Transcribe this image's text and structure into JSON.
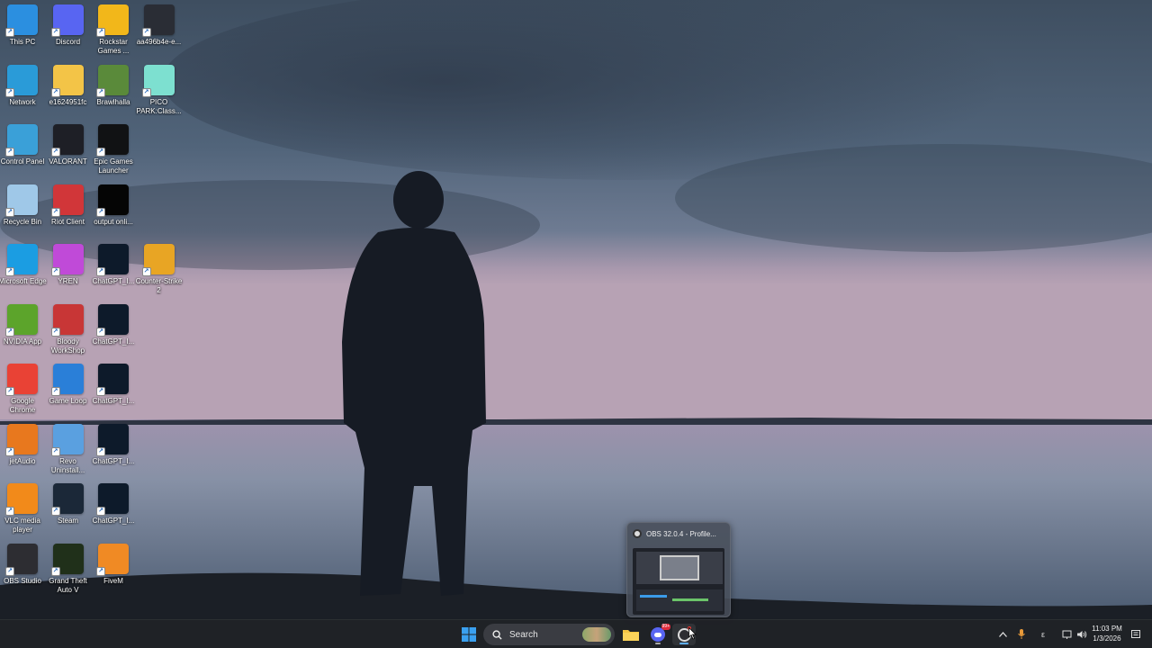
{
  "desktop": {
    "icons": [
      {
        "label": "This PC",
        "icon": "this-pc-icon",
        "color": "#2b8fe0"
      },
      {
        "label": "Discord",
        "icon": "discord-icon",
        "color": "#5865f2"
      },
      {
        "label": "Rockstar Games ...",
        "icon": "rockstar-icon",
        "color": "#f2b71a"
      },
      {
        "label": "aa496b4e-e...",
        "icon": "file-icon",
        "color": "#2a2d35"
      },
      {
        "label": "Network",
        "icon": "network-icon",
        "color": "#2a9bd8"
      },
      {
        "label": "e1624951fc",
        "icon": "folder-icon",
        "color": "#f3c447"
      },
      {
        "label": "Brawlhalla",
        "icon": "brawlhalla-icon",
        "color": "#5a8a3a"
      },
      {
        "label": "PICO PARK:Class...",
        "icon": "pico-park-icon",
        "color": "#7de0d0"
      },
      {
        "label": "Control Panel",
        "icon": "control-panel-icon",
        "color": "#3aa0d8"
      },
      {
        "label": "VALORANT",
        "icon": "valorant-icon",
        "color": "#1e1f26"
      },
      {
        "label": "Epic Games Launcher",
        "icon": "epic-games-icon",
        "color": "#111214"
      },
      {
        "label": "Recycle Bin",
        "icon": "recycle-bin-icon",
        "color": "#9fc8e8"
      },
      {
        "label": "Riot Client",
        "icon": "riot-client-icon",
        "color": "#d13639"
      },
      {
        "label": "output onli...",
        "icon": "black-file-icon",
        "color": "#050505"
      },
      {
        "label": "Microsoft Edge",
        "icon": "edge-icon",
        "color": "#1b9de2"
      },
      {
        "label": "YREN",
        "icon": "app-icon",
        "color": "#c04ad8"
      },
      {
        "label": "ChatGPT_I...",
        "icon": "image-file-icon",
        "color": "#0d1a2a"
      },
      {
        "label": "Counter-Strike 2",
        "icon": "counter-strike-icon",
        "color": "#e8a524"
      },
      {
        "label": "NVIDIA App",
        "icon": "nvidia-icon",
        "color": "#5ca42b"
      },
      {
        "label": "Bloody WorkShop",
        "icon": "bloody-workshop-icon",
        "color": "#c83636"
      },
      {
        "label": "ChatGPT_I...",
        "icon": "image-file-icon",
        "color": "#0d1a2a"
      },
      {
        "label": "Google Chrome",
        "icon": "chrome-icon",
        "color": "#e94235"
      },
      {
        "label": "Game Loop",
        "icon": "game-loop-icon",
        "color": "#2a7fd8"
      },
      {
        "label": "ChatGPT_I...",
        "icon": "image-file-icon",
        "color": "#0d1a2a"
      },
      {
        "label": "jetAudio",
        "icon": "jetaudio-icon",
        "color": "#e8781e"
      },
      {
        "label": "Revo Uninstall...",
        "icon": "revo-uninstaller-icon",
        "color": "#5aa0e0"
      },
      {
        "label": "ChatGPT_I...",
        "icon": "image-file-icon",
        "color": "#0d1a2a"
      },
      {
        "label": "VLC media player",
        "icon": "vlc-icon",
        "color": "#f28a1a"
      },
      {
        "label": "Steam",
        "icon": "steam-icon",
        "color": "#1b2838"
      },
      {
        "label": "ChatGPT_I...",
        "icon": "image-file-icon",
        "color": "#0d1a2a"
      },
      {
        "label": "OBS Studio",
        "icon": "obs-icon",
        "color": "#2d2d32"
      },
      {
        "label": "Grand Theft Auto V",
        "icon": "gta-icon",
        "color": "#20301a"
      },
      {
        "label": "FiveM",
        "icon": "fivem-icon",
        "color": "#f08a24"
      }
    ]
  },
  "obs_preview": {
    "title": "OBS 32.0.4 - Profile..."
  },
  "taskbar": {
    "search_label": "Search",
    "clock_time": "11:03 PM",
    "clock_date": "1/3/2026",
    "discord_badge": "99+"
  }
}
